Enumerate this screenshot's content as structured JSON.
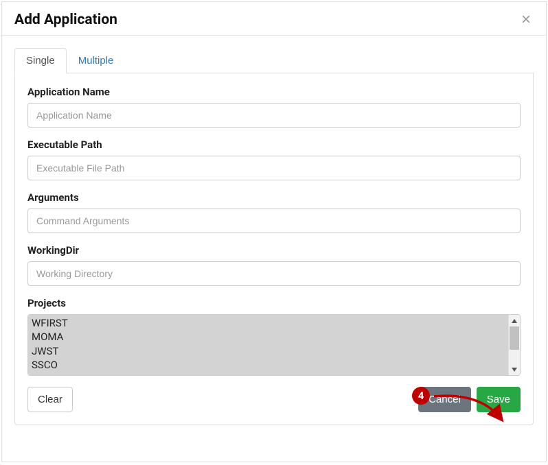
{
  "modal": {
    "title": "Add Application"
  },
  "tabs": {
    "single": "Single",
    "multiple": "Multiple"
  },
  "fields": {
    "app_name": {
      "label": "Application Name",
      "placeholder": "Application Name"
    },
    "exec_path": {
      "label": "Executable Path",
      "placeholder": "Executable File Path"
    },
    "arguments": {
      "label": "Arguments",
      "placeholder": "Command Arguments"
    },
    "working_dir": {
      "label": "WorkingDir",
      "placeholder": "Working Directory"
    },
    "projects": {
      "label": "Projects",
      "options": [
        "WFIRST",
        "MOMA",
        "JWST",
        "SSCO"
      ]
    }
  },
  "buttons": {
    "clear": "Clear",
    "cancel": "Cancel",
    "save": "Save"
  },
  "annotation": {
    "badge": "4"
  }
}
